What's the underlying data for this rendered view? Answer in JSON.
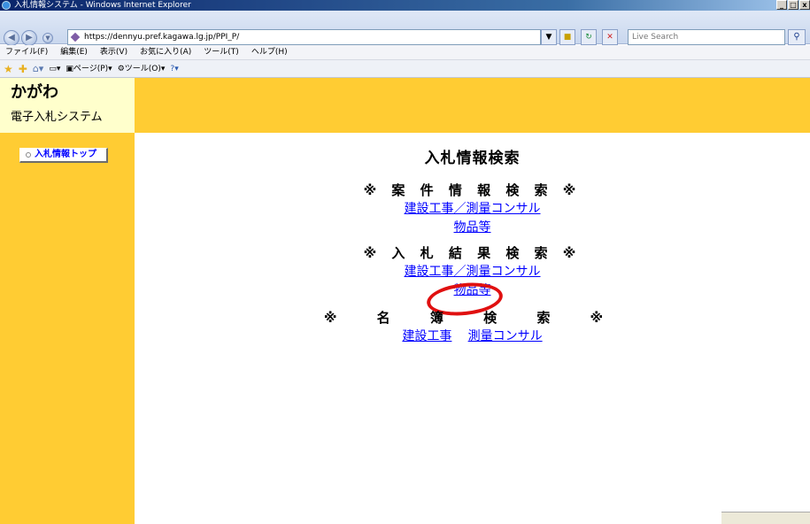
{
  "window": {
    "title": "入札情報システム - Windows Internet Explorer",
    "controls": [
      "_",
      "□",
      "x"
    ]
  },
  "address": {
    "url": "https://dennyu.pref.kagawa.lg.jp/PPI_P/",
    "search_placeholder": "Live Search"
  },
  "menu": [
    "ファイル(F)",
    "編集(E)",
    "表示(V)",
    "お気に入り(A)",
    "ツール(T)",
    "ヘルプ(H)"
  ],
  "command": {
    "page_label": "ページ(P)",
    "tools_label": "ツール(O)"
  },
  "logo": {
    "main": "かがわ",
    "sub": "電子入札システム"
  },
  "sidebar": {
    "top_button": "入札情報トップ"
  },
  "main": {
    "title": "入札情報検索",
    "sections": [
      {
        "heading": "※ 案 件 情 報 検 索 ※",
        "links": [
          "建設工事／測量コンサル",
          "物品等"
        ]
      },
      {
        "heading": "※ 入 札 結 果 検 索 ※",
        "links": [
          "建設工事／測量コンサル",
          "物品等"
        ]
      },
      {
        "heading": "※ 名 簿 検 索 ※",
        "links": [
          "建設工事",
          "測量コンサル"
        ]
      }
    ]
  },
  "colors": {
    "banner": "#ffcc33",
    "logo_bg": "#ffffcc",
    "link": "#0000ff",
    "highlight_circle": "#e01010"
  }
}
